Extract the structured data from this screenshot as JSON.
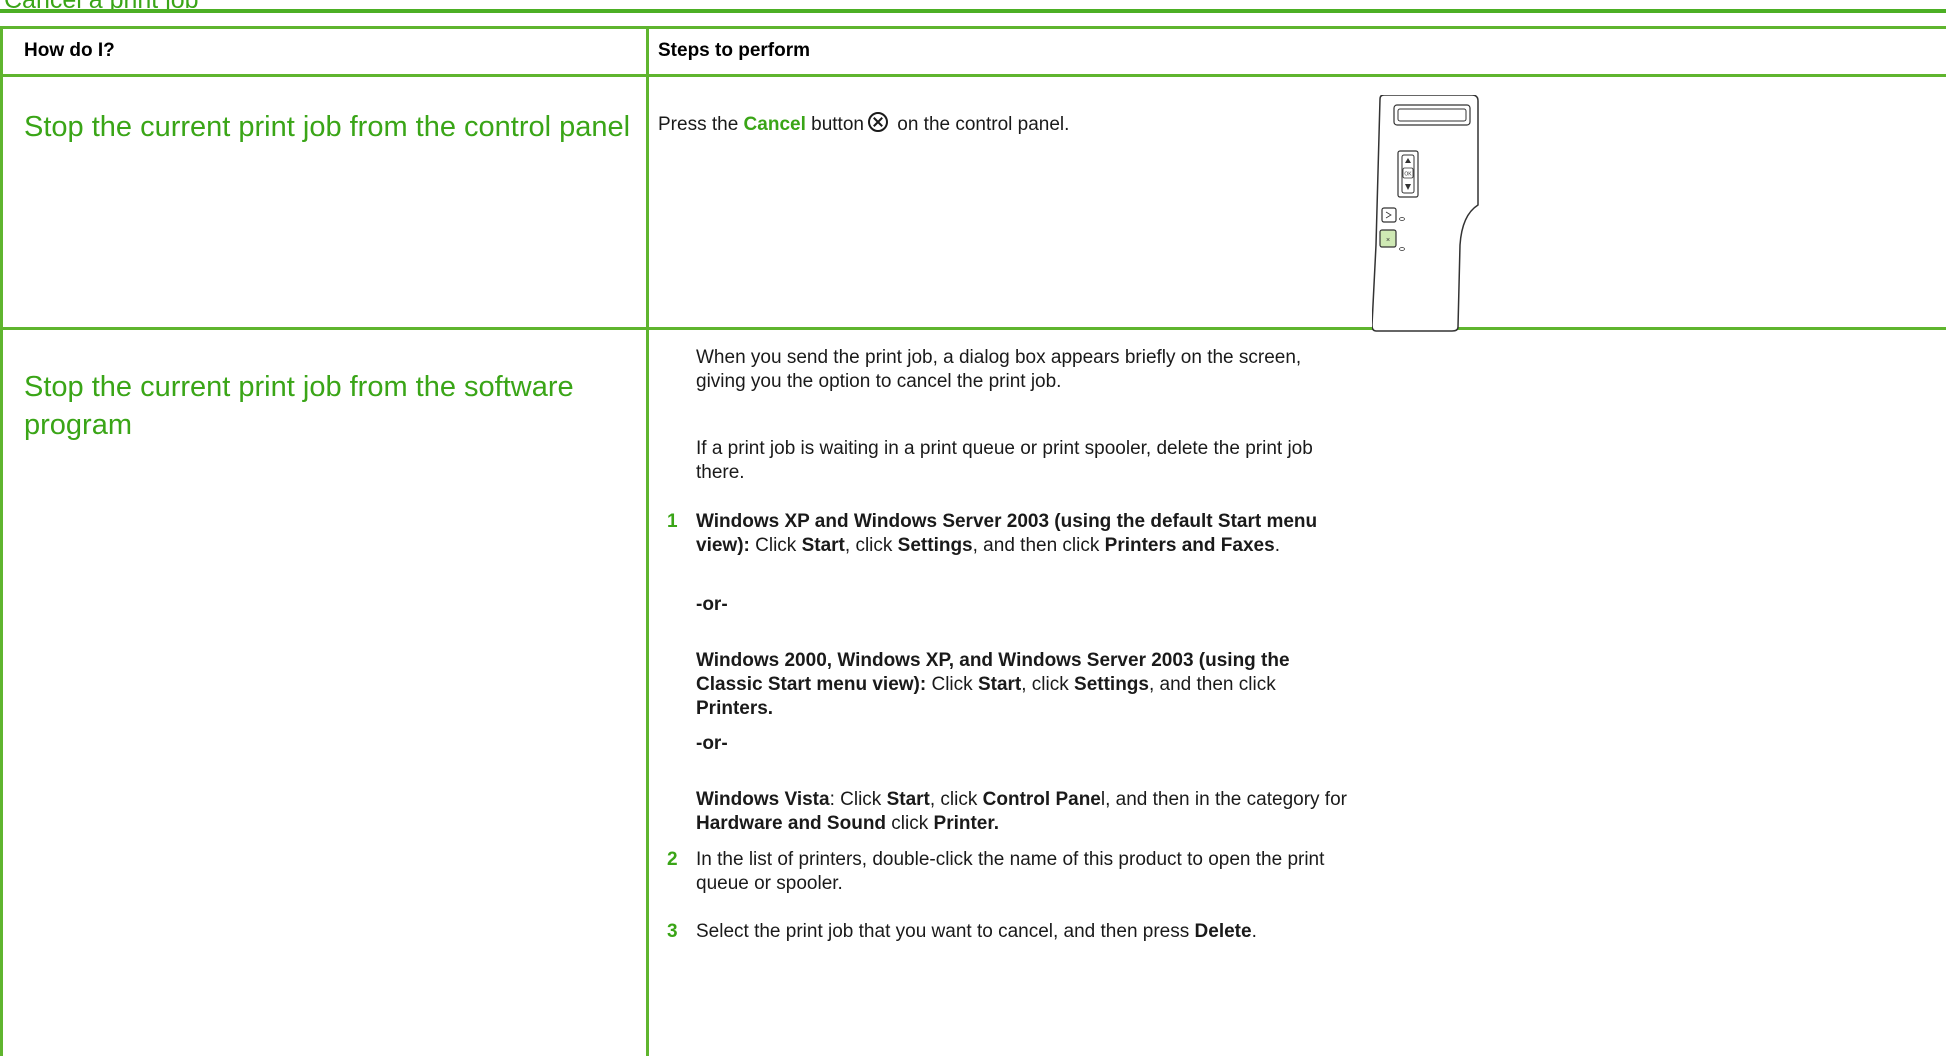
{
  "page_title": "Cancel a print job",
  "table": {
    "col1_header": "How do I?",
    "col2_header": "Steps to perform"
  },
  "row1": {
    "task": "Stop the current print job from the control panel",
    "instruction_prefix": "Press the ",
    "cancel_word": "Cancel",
    "instruction_mid": " button",
    "instruction_suffix": " on the control panel.",
    "panel_ok_label": "OK",
    "panel_cancel_label": "×"
  },
  "row2": {
    "task": "Stop the current print job from the software program",
    "intro1": "When you send the print job, a dialog box appears briefly on the screen, giving you the option to cancel the print job.",
    "intro2": "If a print job is waiting in a print queue or print spooler, delete the print job there.",
    "steps": [
      {
        "number": "1"
      },
      {
        "number": "2",
        "text": "In the list of printers, double-click the name of this product to open the print queue or spooler."
      },
      {
        "number": "3"
      }
    ],
    "step1_xp": {
      "bold_intro": "Windows XP and Windows Server 2003 (using the default Start menu view):",
      "t1": " Click ",
      "b1": "Start",
      "t2": ", click ",
      "b2": "Settings",
      "t3": ", and then click ",
      "b3": "Printers and Faxes",
      "t4": "."
    },
    "or_label": "-or-",
    "step1_classic": {
      "bold_intro": "Windows 2000, Windows XP, and Windows Server 2003 (using the Classic Start menu view):",
      "t1": " Click ",
      "b1": "Start",
      "t2": ", click ",
      "b2": "Settings",
      "t3": ", and then click ",
      "b3": "Printers."
    },
    "step1_vista": {
      "bold_intro": "Windows Vista",
      "t1": ": Click ",
      "b1": "Start",
      "t2": ", click ",
      "b2": "Control Pane",
      "t3": "l, and then in the category for ",
      "b3": "Hardware and Sound",
      "t4": " click ",
      "b4": "Printer."
    },
    "step3": {
      "t1": "Select the print job that you want to cancel, and then press ",
      "b1": "Delete",
      "t2": "."
    }
  }
}
